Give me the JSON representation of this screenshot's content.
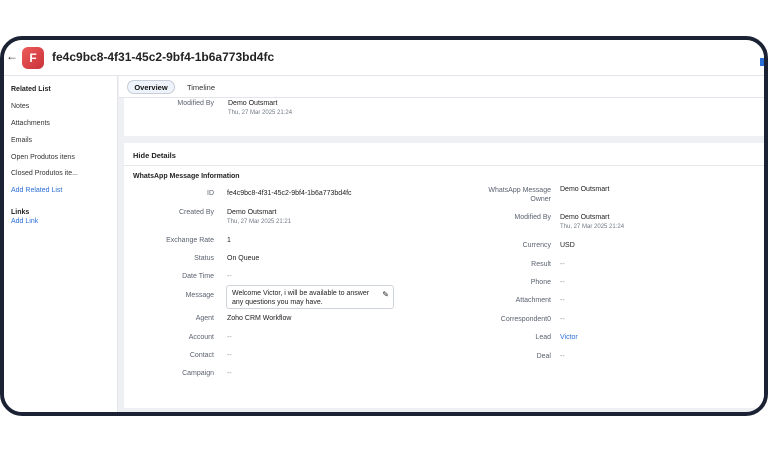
{
  "header": {
    "avatar_letter": "F",
    "record_id": "fe4c9bc8-4f31-45c2-9bf4-1b6a773bd4fc"
  },
  "sidebar": {
    "related_list_title": "Related List",
    "items": [
      "Notes",
      "Attachments",
      "Emails",
      "Open Produtos itens",
      "Closed Produtos ite..."
    ],
    "add_related_list": "Add Related List",
    "links_title": "Links",
    "add_link": "Add Link"
  },
  "tabs": [
    "Overview",
    "Timeline"
  ],
  "top_card": {
    "modified_by_label": "Modified By",
    "modified_by_value": "Demo Outsmart",
    "modified_time": "Thu, 27 Mar 2025 21:24"
  },
  "details": {
    "hide_details": "Hide Details",
    "section_title": "WhatsApp Message Information",
    "left": {
      "id_label": "ID",
      "id_value": "fe4c9bc8-4f31-45c2-9bf4-1b6a773bd4fc",
      "created_by_label": "Created By",
      "created_by_value": "Demo Outsmart",
      "created_time": "Thu, 27 Mar 2025 21:21",
      "exchange_rate_label": "Exchange Rate",
      "exchange_rate_value": "1",
      "status_label": "Status",
      "status_value": "On Queue",
      "date_time_label": "Date Time",
      "date_time_value": "--",
      "message_label": "Message",
      "message_value": "Welcome Victor, i will be available to answer any questions you may have.",
      "agent_label": "Agent",
      "agent_value": "Zoho CRM Workflow",
      "account_label": "Account",
      "account_value": "--",
      "contact_label": "Contact",
      "contact_value": "--",
      "campaign_label": "Campaign",
      "campaign_value": "--"
    },
    "right": {
      "owner_label_1": "WhatsApp Message",
      "owner_label_2": "Owner",
      "owner_value": "Demo Outsmart",
      "modified_by_label": "Modified By",
      "modified_by_value": "Demo Outsmart",
      "modified_time": "Thu, 27 Mar 2025 21:24",
      "currency_label": "Currency",
      "currency_value": "USD",
      "result_label": "Result",
      "result_value": "--",
      "phone_label": "Phone",
      "phone_value": "--",
      "attachment_label": "Attachment",
      "attachment_value": "--",
      "correspondent_label": "Correspondent0",
      "correspondent_value": "--",
      "lead_label": "Lead",
      "lead_value": "Victor",
      "deal_label": "Deal",
      "deal_value": "--"
    }
  },
  "icons": {
    "back": "back-arrow-icon",
    "edit": "pencil-icon"
  },
  "colors": {
    "link": "#2b6fd6",
    "avatar": "#d93f45",
    "frame": "#1b2233"
  }
}
